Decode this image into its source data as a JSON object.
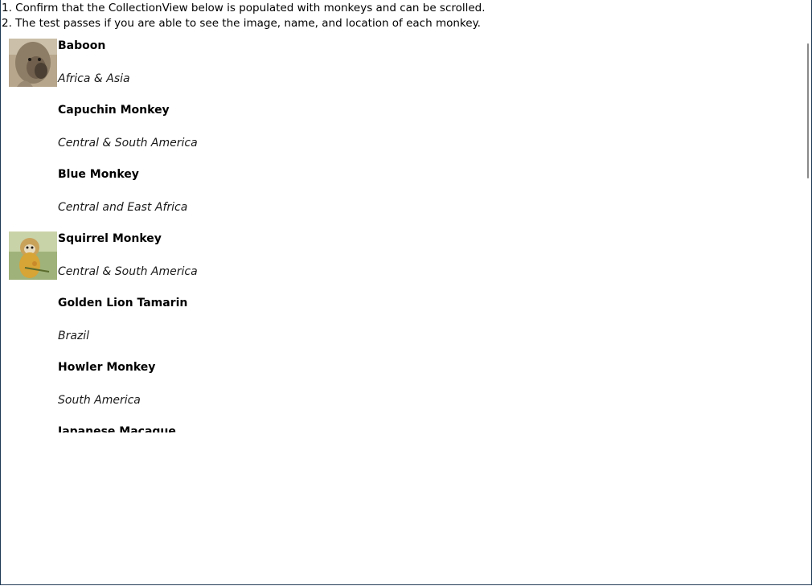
{
  "instructions": {
    "line1": "1. Confirm that the CollectionView below is populated with monkeys and can be scrolled.",
    "line2": "2. The test passes if you are able to see the image, name, and location of each monkey."
  },
  "monkeys": [
    {
      "name": "Baboon",
      "location": "Africa & Asia",
      "has_image": true,
      "icon": "baboon-photo"
    },
    {
      "name": "Capuchin Monkey",
      "location": "Central & South America",
      "has_image": false
    },
    {
      "name": "Blue Monkey",
      "location": "Central and East Africa",
      "has_image": false
    },
    {
      "name": "Squirrel Monkey",
      "location": "Central & South America",
      "has_image": true,
      "icon": "squirrel-monkey-photo"
    },
    {
      "name": "Golden Lion Tamarin",
      "location": "Brazil",
      "has_image": false
    },
    {
      "name": "Howler Monkey",
      "location": "South America",
      "has_image": false
    },
    {
      "name": "Japanese Macaque",
      "location": "",
      "has_image": false
    }
  ],
  "colors": {
    "window_border": "#1f3a55",
    "scrollbar_thumb": "#8a8a8a"
  }
}
